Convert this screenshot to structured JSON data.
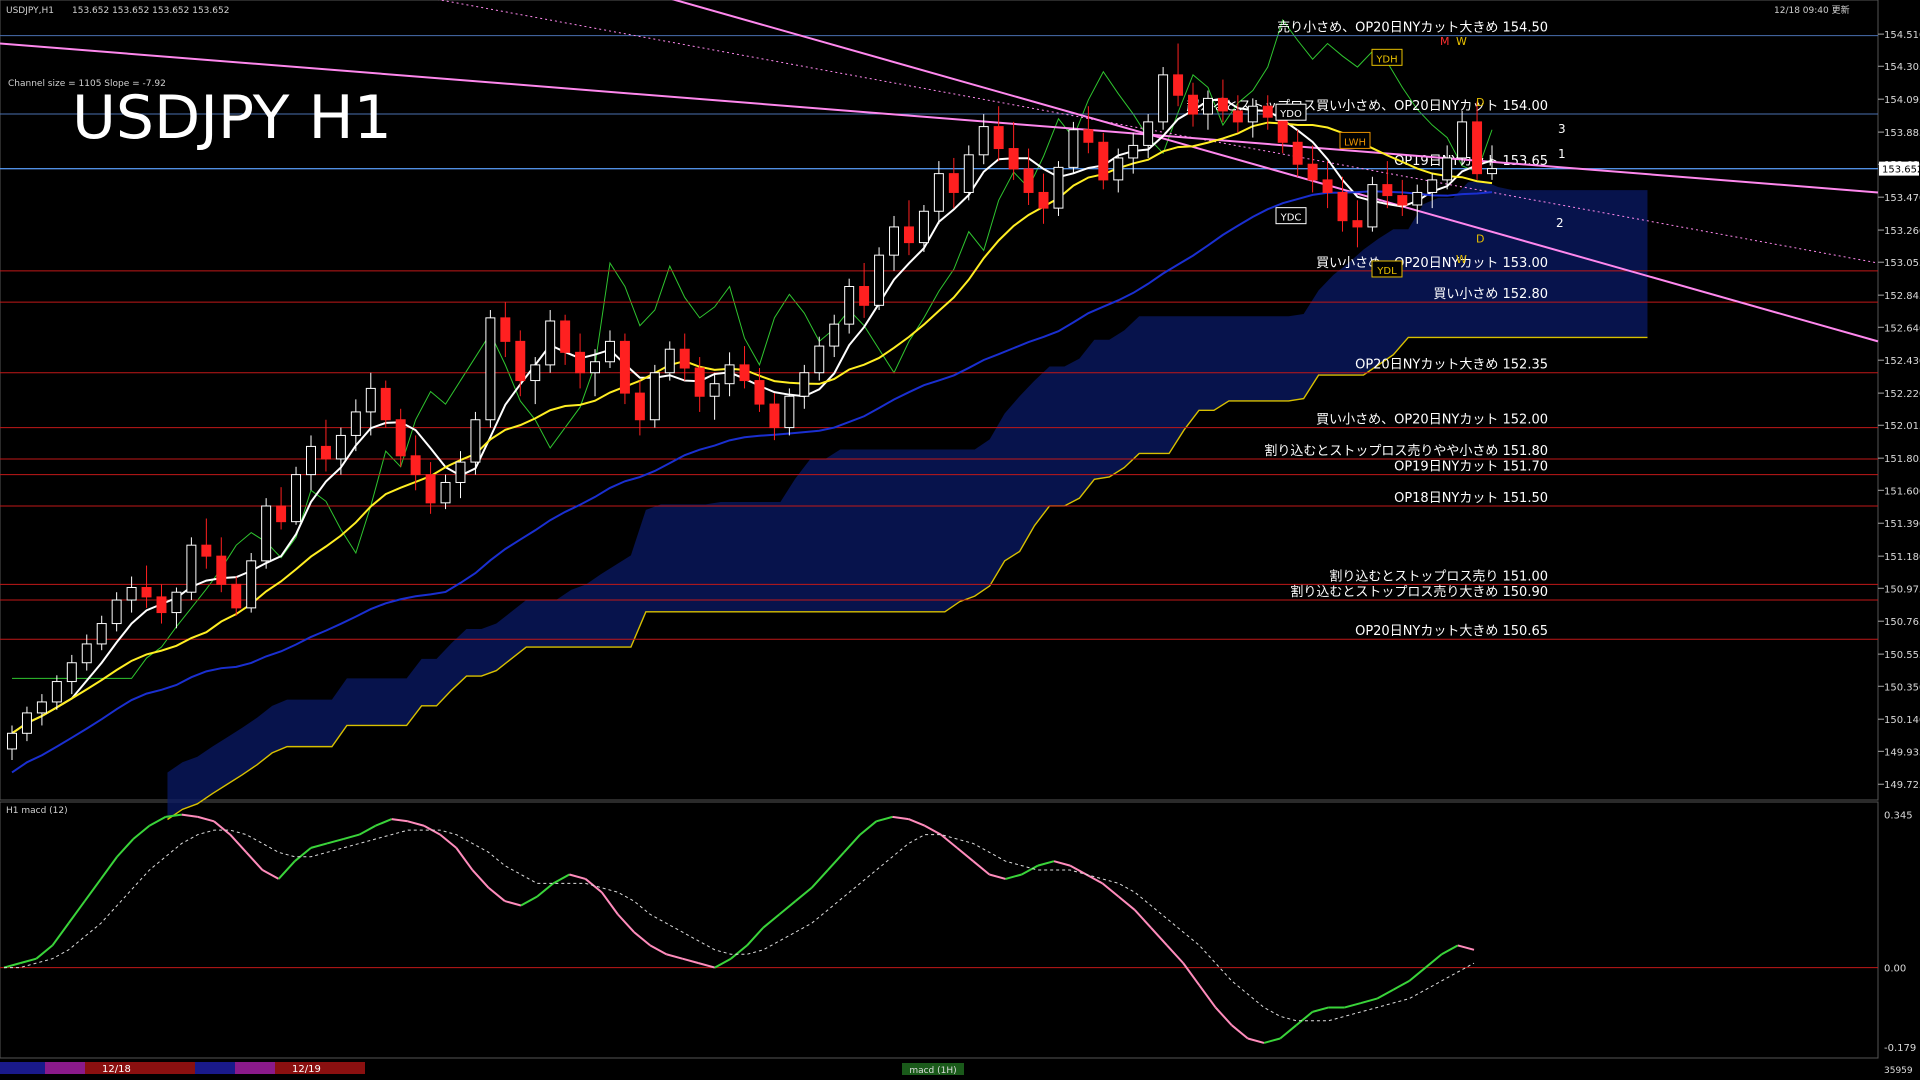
{
  "header": {
    "symbol_info": "USDJPY,H1",
    "ohlc": "153.652 153.652 153.652 153.652",
    "timestamp": "12/18 09:40 更新",
    "channel_info": "Channel size = 1105 Slope = -7.92",
    "title": "USDJPY H1"
  },
  "colors": {
    "background": "#000000",
    "candle_up": "#ffffff",
    "candle_down": "#ff2020",
    "sma_fast": "#ffffff",
    "sma_mid": "#ffee22",
    "sma_slow": "#1a2fd0",
    "level_line": "#c01818",
    "current_line": "#5aa0ff",
    "channel": "#ff88ee",
    "cloud_outline": "#d8c000",
    "macd_up": "#3ad43a",
    "macd_down": "#ff8cbc"
  },
  "chart_data": [
    {
      "type": "line",
      "panel": "price",
      "price_axis": {
        "ylim": [
          149.65,
          154.6
        ],
        "ticks": [
          "154.510",
          "154.305",
          "154.095",
          "153.885",
          "153.680",
          "153.470",
          "153.260",
          "153.055",
          "152.845",
          "152.640",
          "152.430",
          "152.220",
          "152.015",
          "151.805",
          "151.600",
          "151.390",
          "151.180",
          "150.975",
          "150.765",
          "150.555",
          "150.350",
          "150.140",
          "149.935",
          "149.725"
        ],
        "current_price": "153.652"
      },
      "candles": [
        [
          149.95,
          150.1,
          149.88,
          150.05
        ],
        [
          150.05,
          150.22,
          150.0,
          150.18
        ],
        [
          150.18,
          150.3,
          150.1,
          150.25
        ],
        [
          150.25,
          150.42,
          150.2,
          150.38
        ],
        [
          150.38,
          150.55,
          150.3,
          150.5
        ],
        [
          150.5,
          150.68,
          150.45,
          150.62
        ],
        [
          150.62,
          150.8,
          150.58,
          150.75
        ],
        [
          150.75,
          150.95,
          150.7,
          150.9
        ],
        [
          150.9,
          151.05,
          150.82,
          150.98
        ],
        [
          150.98,
          151.12,
          150.85,
          150.92
        ],
        [
          150.92,
          151.0,
          150.75,
          150.82
        ],
        [
          150.82,
          150.98,
          150.72,
          150.95
        ],
        [
          150.95,
          151.3,
          150.9,
          151.25
        ],
        [
          151.25,
          151.42,
          151.1,
          151.18
        ],
        [
          151.18,
          151.3,
          150.95,
          151.0
        ],
        [
          151.0,
          151.05,
          150.8,
          150.85
        ],
        [
          150.85,
          151.2,
          150.82,
          151.15
        ],
        [
          151.15,
          151.55,
          151.1,
          151.5
        ],
        [
          151.5,
          151.62,
          151.35,
          151.4
        ],
        [
          151.4,
          151.75,
          151.38,
          151.7
        ],
        [
          151.7,
          151.95,
          151.6,
          151.88
        ],
        [
          151.88,
          152.05,
          151.72,
          151.8
        ],
        [
          151.8,
          152.0,
          151.7,
          151.95
        ],
        [
          151.95,
          152.18,
          151.85,
          152.1
        ],
        [
          152.1,
          152.35,
          151.95,
          152.25
        ],
        [
          152.25,
          152.3,
          152.0,
          152.05
        ],
        [
          152.05,
          152.12,
          151.75,
          151.82
        ],
        [
          151.82,
          151.95,
          151.6,
          151.7
        ],
        [
          151.7,
          151.78,
          151.45,
          151.52
        ],
        [
          151.52,
          151.7,
          151.48,
          151.65
        ],
        [
          151.65,
          151.85,
          151.55,
          151.78
        ],
        [
          151.78,
          152.1,
          151.7,
          152.05
        ],
        [
          152.05,
          152.75,
          152.0,
          152.7
        ],
        [
          152.7,
          152.8,
          152.45,
          152.55
        ],
        [
          152.55,
          152.62,
          152.2,
          152.3
        ],
        [
          152.3,
          152.45,
          152.15,
          152.4
        ],
        [
          152.4,
          152.75,
          152.35,
          152.68
        ],
        [
          152.68,
          152.72,
          152.4,
          152.48
        ],
        [
          152.48,
          152.6,
          152.25,
          152.35
        ],
        [
          152.35,
          152.5,
          152.2,
          152.42
        ],
        [
          152.42,
          152.62,
          152.38,
          152.55
        ],
        [
          152.55,
          152.6,
          152.15,
          152.22
        ],
        [
          152.22,
          152.3,
          151.95,
          152.05
        ],
        [
          152.05,
          152.4,
          152.0,
          152.35
        ],
        [
          152.35,
          152.55,
          152.3,
          152.5
        ],
        [
          152.5,
          152.6,
          152.3,
          152.38
        ],
        [
          152.38,
          152.45,
          152.1,
          152.2
        ],
        [
          152.2,
          152.35,
          152.05,
          152.28
        ],
        [
          152.28,
          152.48,
          152.2,
          152.4
        ],
        [
          152.4,
          152.52,
          152.25,
          152.3
        ],
        [
          152.3,
          152.38,
          152.1,
          152.15
        ],
        [
          152.15,
          152.22,
          151.92,
          152.0
        ],
        [
          152.0,
          152.25,
          151.95,
          152.2
        ],
        [
          152.2,
          152.4,
          152.12,
          152.35
        ],
        [
          152.35,
          152.58,
          152.3,
          152.52
        ],
        [
          152.52,
          152.72,
          152.45,
          152.66
        ],
        [
          152.66,
          152.95,
          152.6,
          152.9
        ],
        [
          152.9,
          153.05,
          152.7,
          152.78
        ],
        [
          152.78,
          153.15,
          152.75,
          153.1
        ],
        [
          153.1,
          153.35,
          153.0,
          153.28
        ],
        [
          153.28,
          153.45,
          153.1,
          153.18
        ],
        [
          153.18,
          153.42,
          153.12,
          153.38
        ],
        [
          153.38,
          153.7,
          153.3,
          153.62
        ],
        [
          153.62,
          153.72,
          153.4,
          153.5
        ],
        [
          153.5,
          153.8,
          153.45,
          153.74
        ],
        [
          153.74,
          154.0,
          153.68,
          153.92
        ],
        [
          153.92,
          154.05,
          153.7,
          153.78
        ],
        [
          153.78,
          153.95,
          153.58,
          153.65
        ],
        [
          153.65,
          153.78,
          153.42,
          153.5
        ],
        [
          153.5,
          153.62,
          153.3,
          153.4
        ],
        [
          153.4,
          153.7,
          153.35,
          153.66
        ],
        [
          153.66,
          153.95,
          153.62,
          153.9
        ],
        [
          153.9,
          154.05,
          153.75,
          153.82
        ],
        [
          153.82,
          153.88,
          153.52,
          153.58
        ],
        [
          153.58,
          153.78,
          153.5,
          153.72
        ],
        [
          153.72,
          153.88,
          153.62,
          153.8
        ],
        [
          153.8,
          154.0,
          153.72,
          153.95
        ],
        [
          153.95,
          154.3,
          153.9,
          154.25
        ],
        [
          154.25,
          154.45,
          154.05,
          154.12
        ],
        [
          154.12,
          154.2,
          153.92,
          154.0
        ],
        [
          154.0,
          154.15,
          153.9,
          154.1
        ],
        [
          154.1,
          154.22,
          153.95,
          154.02
        ],
        [
          154.02,
          154.12,
          153.88,
          153.95
        ],
        [
          153.95,
          154.1,
          153.85,
          154.05
        ],
        [
          154.05,
          154.12,
          153.9,
          153.98
        ],
        [
          153.98,
          154.05,
          153.75,
          153.82
        ],
        [
          153.82,
          153.9,
          153.6,
          153.68
        ],
        [
          153.68,
          153.8,
          153.5,
          153.58
        ],
        [
          153.58,
          153.7,
          153.4,
          153.5
        ],
        [
          153.5,
          153.6,
          153.25,
          153.32
        ],
        [
          153.32,
          153.45,
          153.15,
          153.28
        ],
        [
          153.28,
          153.6,
          153.25,
          153.55
        ],
        [
          153.55,
          153.7,
          153.4,
          153.48
        ],
        [
          153.48,
          153.58,
          153.35,
          153.42
        ],
        [
          153.42,
          153.55,
          153.3,
          153.5
        ],
        [
          153.5,
          153.62,
          153.4,
          153.58
        ],
        [
          153.58,
          153.8,
          153.52,
          153.72
        ],
        [
          153.72,
          154.02,
          153.68,
          153.95
        ],
        [
          153.95,
          154.08,
          153.58,
          153.62
        ],
        [
          153.62,
          153.8,
          153.58,
          153.652
        ]
      ],
      "levels": [
        {
          "price": 154.5,
          "label": "売り小さめ、OP20日NYカット大きめ 154.50",
          "color": "#4a6fb0"
        },
        {
          "price": 154.0,
          "label": "超えるとストップロス買い小さめ、OP20日NYカット 154.00",
          "color": "#4a6fb0"
        },
        {
          "price": 153.65,
          "label": "OP19日NYカット 153.65",
          "color": "#4a6fb0"
        },
        {
          "price": 153.0,
          "label": "買い小さめ、OP20日NYカット 153.00",
          "color": "#c01818"
        },
        {
          "price": 152.8,
          "label": "買い小さめ 152.80",
          "color": "#c01818"
        },
        {
          "price": 152.35,
          "label": "OP20日NYカット大きめ 152.35",
          "color": "#c01818"
        },
        {
          "price": 152.0,
          "label": "買い小さめ、OP20日NYカット 152.00",
          "color": "#c01818"
        },
        {
          "price": 151.8,
          "label": "割り込むとストップロス売りやや小さめ 151.80",
          "color": "#c01818"
        },
        {
          "price": 151.7,
          "label": "OP19日NYカット 151.70",
          "color": "#c01818"
        },
        {
          "price": 151.5,
          "label": "OP18日NYカット 151.50",
          "color": "#c01818"
        },
        {
          "price": 151.0,
          "label": "割り込むとストップロス売り 151.00",
          "color": "#c01818"
        },
        {
          "price": 150.9,
          "label": "割り込むとストップロス売り大きめ 150.90",
          "color": "#c01818"
        },
        {
          "price": 150.65,
          "label": "OP20日NYカット大きめ 150.65",
          "color": "#c01818"
        }
      ],
      "markers": {
        "day_labels": [
          "YDH",
          "YDO",
          "YDC",
          "YDL",
          "LWH"
        ],
        "d_labels": [
          "D",
          "D"
        ],
        "w_labels": [
          "W",
          "W"
        ],
        "m_label": "M",
        "wave_labels": [
          "3",
          "1",
          "2"
        ]
      }
    },
    {
      "type": "line",
      "panel": "macd",
      "title": "H1 macd (12)",
      "ticks": [
        "0.345",
        "0.00",
        "-0.179"
      ],
      "ylim": [
        -0.195,
        0.36
      ],
      "macd": [
        0.0,
        0.01,
        0.02,
        0.05,
        0.1,
        0.15,
        0.2,
        0.25,
        0.29,
        0.32,
        0.34,
        0.345,
        0.34,
        0.33,
        0.3,
        0.26,
        0.22,
        0.2,
        0.24,
        0.27,
        0.28,
        0.29,
        0.3,
        0.32,
        0.335,
        0.33,
        0.32,
        0.3,
        0.27,
        0.22,
        0.18,
        0.15,
        0.14,
        0.16,
        0.19,
        0.21,
        0.2,
        0.17,
        0.12,
        0.08,
        0.05,
        0.03,
        0.02,
        0.01,
        0.0,
        0.02,
        0.05,
        0.09,
        0.12,
        0.15,
        0.18,
        0.22,
        0.26,
        0.3,
        0.33,
        0.34,
        0.335,
        0.32,
        0.3,
        0.27,
        0.24,
        0.21,
        0.2,
        0.21,
        0.23,
        0.24,
        0.23,
        0.21,
        0.19,
        0.16,
        0.13,
        0.09,
        0.05,
        0.01,
        -0.04,
        -0.09,
        -0.13,
        -0.16,
        -0.17,
        -0.16,
        -0.13,
        -0.1,
        -0.09,
        -0.09,
        -0.08,
        -0.07,
        -0.05,
        -0.03,
        0.0,
        0.03,
        0.05,
        0.04
      ],
      "signal": [
        0.0,
        0.0,
        0.01,
        0.02,
        0.04,
        0.07,
        0.1,
        0.14,
        0.18,
        0.22,
        0.25,
        0.28,
        0.3,
        0.31,
        0.31,
        0.3,
        0.28,
        0.26,
        0.25,
        0.25,
        0.26,
        0.27,
        0.28,
        0.29,
        0.3,
        0.31,
        0.31,
        0.31,
        0.3,
        0.28,
        0.26,
        0.23,
        0.21,
        0.19,
        0.19,
        0.19,
        0.19,
        0.18,
        0.17,
        0.15,
        0.12,
        0.1,
        0.08,
        0.06,
        0.04,
        0.03,
        0.03,
        0.04,
        0.06,
        0.08,
        0.1,
        0.13,
        0.16,
        0.19,
        0.22,
        0.25,
        0.28,
        0.3,
        0.3,
        0.29,
        0.28,
        0.26,
        0.24,
        0.23,
        0.22,
        0.22,
        0.22,
        0.21,
        0.2,
        0.19,
        0.17,
        0.14,
        0.11,
        0.08,
        0.05,
        0.01,
        -0.03,
        -0.06,
        -0.09,
        -0.11,
        -0.12,
        -0.12,
        -0.12,
        -0.11,
        -0.1,
        -0.09,
        -0.08,
        -0.07,
        -0.05,
        -0.03,
        -0.01,
        0.01
      ]
    }
  ],
  "footer": {
    "dates": [
      "12/18",
      "12/19"
    ],
    "indicator_tab": "macd (1H)",
    "count": "35959"
  }
}
